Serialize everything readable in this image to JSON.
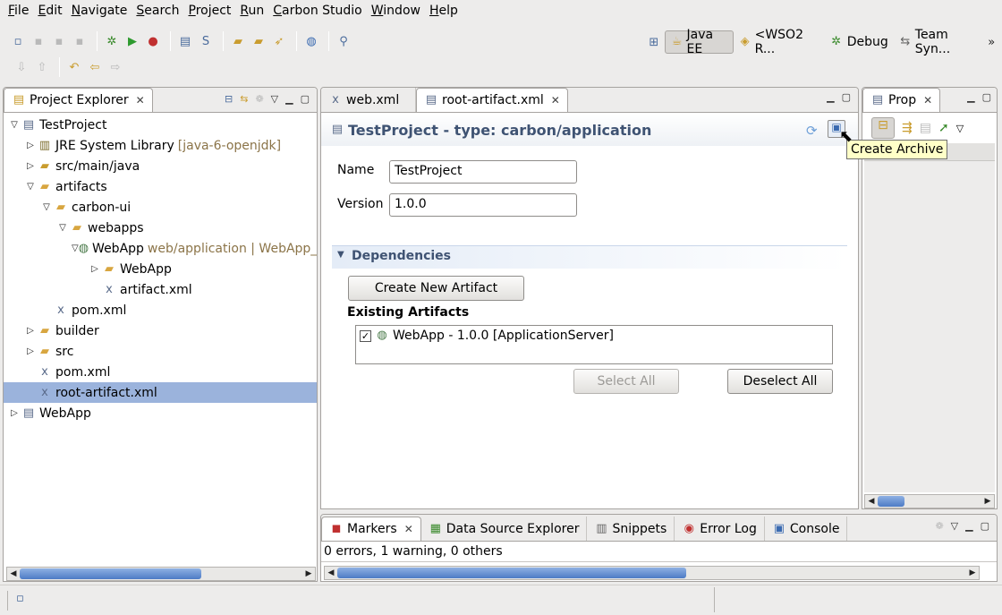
{
  "menu": [
    "File",
    "Edit",
    "Navigate",
    "Search",
    "Project",
    "Run",
    "Carbon Studio",
    "Window",
    "Help"
  ],
  "perspectives": [
    "Java EE",
    "<WSO2 R...",
    "Debug",
    "Team Syn..."
  ],
  "project_explorer": {
    "title": "Project Explorer",
    "tree": [
      {
        "label": "TestProject",
        "suffix": "",
        "depth": 0,
        "twisty": "open",
        "icon": "project-icon"
      },
      {
        "label": "JRE System Library",
        "suffix": "[java-6-openjdk]",
        "depth": 1,
        "twisty": "closed",
        "icon": "library-icon"
      },
      {
        "label": "src/main/java",
        "suffix": "",
        "depth": 1,
        "twisty": "closed",
        "icon": "source-folder-icon"
      },
      {
        "label": "artifacts",
        "suffix": "",
        "depth": 1,
        "twisty": "open",
        "icon": "folder-icon"
      },
      {
        "label": "carbon-ui",
        "suffix": "",
        "depth": 2,
        "twisty": "open",
        "icon": "folder-icon"
      },
      {
        "label": "webapps",
        "suffix": "",
        "depth": 3,
        "twisty": "open",
        "icon": "folder-icon"
      },
      {
        "label": "WebApp",
        "suffix": "web/application | WebApp_",
        "depth": 4,
        "twisty": "open",
        "icon": "webapp-icon"
      },
      {
        "label": "WebApp",
        "suffix": "",
        "depth": 5,
        "twisty": "closed",
        "icon": "folder-icon"
      },
      {
        "label": "artifact.xml",
        "suffix": "",
        "depth": 5,
        "twisty": "none",
        "icon": "xml-file-icon"
      },
      {
        "label": "pom.xml",
        "suffix": "",
        "depth": 2,
        "twisty": "none",
        "icon": "xml-file-icon"
      },
      {
        "label": "builder",
        "suffix": "",
        "depth": 1,
        "twisty": "closed",
        "icon": "folder-icon"
      },
      {
        "label": "src",
        "suffix": "",
        "depth": 1,
        "twisty": "closed",
        "icon": "folder-icon"
      },
      {
        "label": "pom.xml",
        "suffix": "",
        "depth": 1,
        "twisty": "none",
        "icon": "xml-file-icon"
      },
      {
        "label": "root-artifact.xml",
        "suffix": "",
        "depth": 1,
        "twisty": "none",
        "icon": "xml-file-icon",
        "selected": true
      },
      {
        "label": "WebApp",
        "suffix": "",
        "depth": 0,
        "twisty": "closed",
        "icon": "project-icon"
      }
    ]
  },
  "editor": {
    "tabs": [
      "web.xml",
      "root-artifact.xml"
    ],
    "header": "TestProject - type: carbon/application",
    "tooltip": "Create Archive",
    "name_label": "Name",
    "name_value": "TestProject",
    "version_label": "Version",
    "version_value": "1.0.0",
    "section": "Dependencies",
    "create_button": "Create New Artifact",
    "existing_label": "Existing Artifacts",
    "artifact_item": "WebApp - 1.0.0 [ApplicationServer]",
    "select_all": "Select All",
    "deselect_all": "Deselect All"
  },
  "properties": {
    "title": "Prop"
  },
  "bottom": {
    "tabs": [
      "Markers",
      "Data Source Explorer",
      "Snippets",
      "Error Log",
      "Console"
    ],
    "status": "0 errors, 1 warning, 0 others"
  },
  "colors": {
    "selection": "#9bb3dc",
    "header_text": "#3f5373",
    "decorator": "#8b7448"
  }
}
